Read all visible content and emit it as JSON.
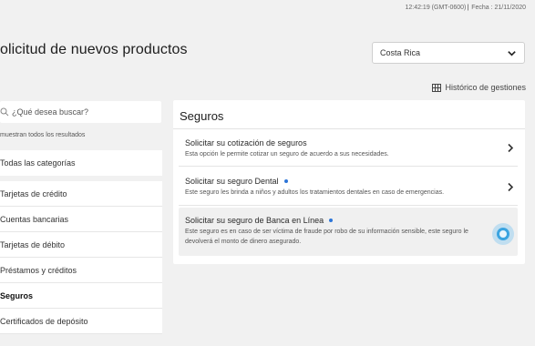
{
  "header": {
    "time": "12:42:19 (GMT-0600)",
    "separator": "|",
    "date": "Fecha : 21/11/2020"
  },
  "page_title": "olicitud de nuevos productos",
  "country_select": {
    "value": "Costa Rica"
  },
  "history_link": "Histórico de gestiones",
  "search": {
    "placeholder": "¿Qué desea buscar?"
  },
  "results_note": "muestran todos los resultados",
  "sidebar": {
    "all_label": "Todas las categorías",
    "items": [
      {
        "label": "Tarjetas de crédito"
      },
      {
        "label": "Cuentas bancarias"
      },
      {
        "label": "Tarjetas de débito"
      },
      {
        "label": "Préstamos y créditos"
      },
      {
        "label": "Seguros"
      },
      {
        "label": "Certificados de depósito"
      }
    ]
  },
  "panel": {
    "title": "Seguros",
    "items": [
      {
        "title": "Solicitar su cotización de seguros",
        "desc": "Esta opción le permite cotizar un seguro de acuerdo a sus necesidades."
      },
      {
        "title": "Solicitar su seguro Dental",
        "desc": "Este seguro les brinda a niños y adultos los tratamientos dentales en caso de emergencias."
      },
      {
        "title": "Solicitar su seguro de Banca en Línea",
        "desc": "Este seguro es en caso de ser víctima de fraude por robo de su información sensible, este seguro le devolverá el monto de dinero asegurado."
      }
    ]
  },
  "colors": {
    "accent": "#2d75d8",
    "cursor": "#3ba4e0"
  },
  "icons": [
    "chevron-down-icon",
    "grid-icon",
    "search-icon",
    "chevron-right-icon"
  ]
}
